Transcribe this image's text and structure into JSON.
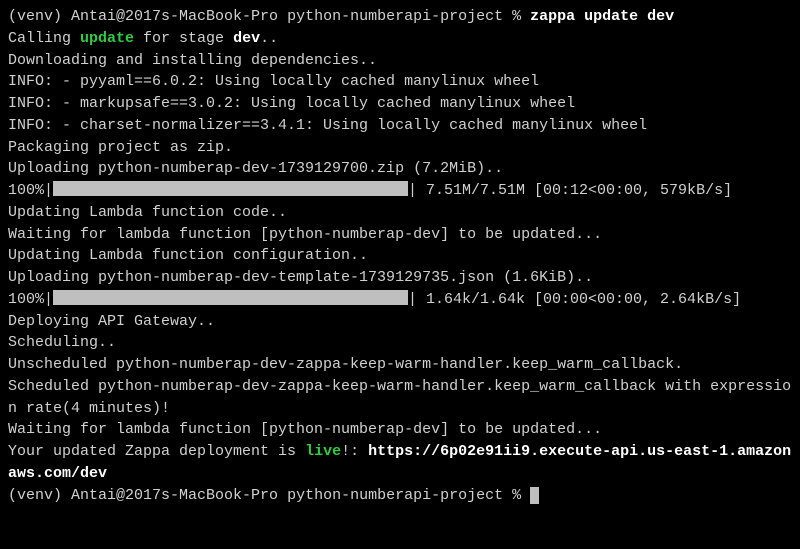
{
  "prompt1": {
    "venv": "(venv) ",
    "userhost": "Antai@2017s-MacBook-Pro",
    "dir": " python-numberapi-project % ",
    "cmd": "zappa update dev"
  },
  "l1a": "Calling ",
  "l1b": "update",
  "l1c": " for stage ",
  "l1d": "dev",
  "l1e": "..",
  "l2": "Downloading and installing dependencies..",
  "l3": "INFO: - pyyaml==6.0.2: Using locally cached manylinux wheel",
  "l4": "INFO: - markupsafe==3.0.2: Using locally cached manylinux wheel",
  "l5": "INFO: - charset-normalizer==3.4.1: Using locally cached manylinux wheel",
  "l6": "Packaging project as zip.",
  "l7": "Uploading python-numberap-dev-1739129700.zip (7.2MiB)..",
  "bar1_left": "100%|",
  "bar1_right": "| 7.51M/7.51M [00:12<00:00, 579kB/s]",
  "l9": "Updating Lambda function code..",
  "l10": "Waiting for lambda function [python-numberap-dev] to be updated...",
  "l11": "Updating Lambda function configuration..",
  "l12": "Uploading python-numberap-dev-template-1739129735.json (1.6KiB)..",
  "bar2_left": "100%|",
  "bar2_right": "| 1.64k/1.64k [00:00<00:00, 2.64kB/s]",
  "l14": "Deploying API Gateway..",
  "l15": "Scheduling..",
  "l16": "Unscheduled python-numberap-dev-zappa-keep-warm-handler.keep_warm_callback.",
  "l17": "Scheduled python-numberap-dev-zappa-keep-warm-handler.keep_warm_callback with expression rate(4 minutes)!",
  "l18": "Waiting for lambda function [python-numberap-dev] to be updated...",
  "l19a": "Your updated Zappa deployment is ",
  "l19b": "live",
  "l19c": "!: ",
  "l19d": "https://6p02e91ii9.execute-api.us-east-1.amazonaws.com/dev",
  "prompt2": {
    "venv": "(venv) ",
    "userhost": "Antai@2017s-MacBook-Pro",
    "dir": " python-numberapi-project % "
  }
}
